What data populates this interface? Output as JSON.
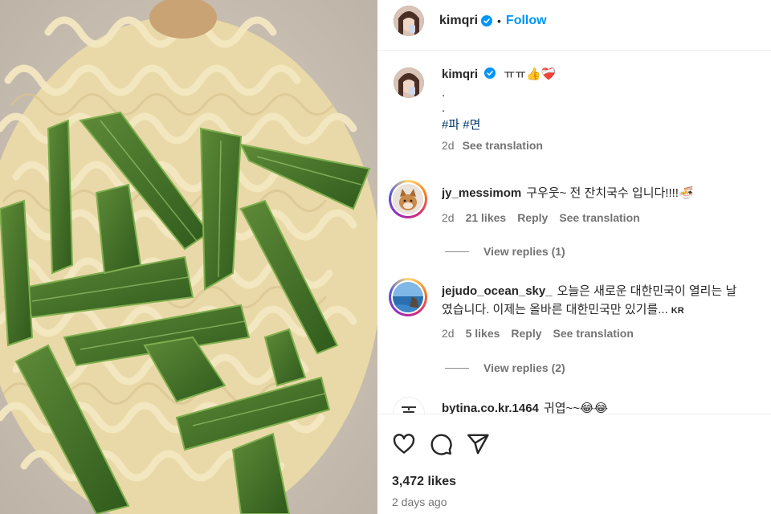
{
  "post_image": {
    "alt_icon": "noodles-photo"
  },
  "header": {
    "username": "kimqri",
    "separator": "•",
    "follow_label": "Follow"
  },
  "caption": {
    "username": "kimqri",
    "text": "ㅠㅠ👍❤️‍🩹",
    "dot1": ".",
    "dot2": ".",
    "hashtags": "#파 #면",
    "time": "2d",
    "see_translation": "See translation"
  },
  "comments": [
    {
      "username": "jy_messimom",
      "text": "구우웃~ 전 잔치국수 입니다!!!!🍜",
      "time": "2d",
      "likes": "21 likes",
      "reply": "Reply",
      "see_translation": "See translation",
      "view_replies": "View replies (1)"
    },
    {
      "username": "jejudo_ocean_sky_",
      "text_line1": "오늘은 새로운 대한민국이 열리는 날",
      "text_line2": "였습니다. 이제는 올바른 대한민국만 있기를...",
      "lang_badge": "KR",
      "time": "2d",
      "likes": "5 likes",
      "reply": "Reply",
      "see_translation": "See translation",
      "view_replies": "View replies (2)"
    },
    {
      "username": "bytina.co.kr.1464",
      "text": "귀엽~~😂😂"
    }
  ],
  "footer": {
    "likes": "3,472 likes",
    "ago": "2 days ago"
  },
  "colors": {
    "accent": "#0095f6",
    "hashtag": "#00376b",
    "muted": "#737373",
    "verified": "#0095f6"
  }
}
